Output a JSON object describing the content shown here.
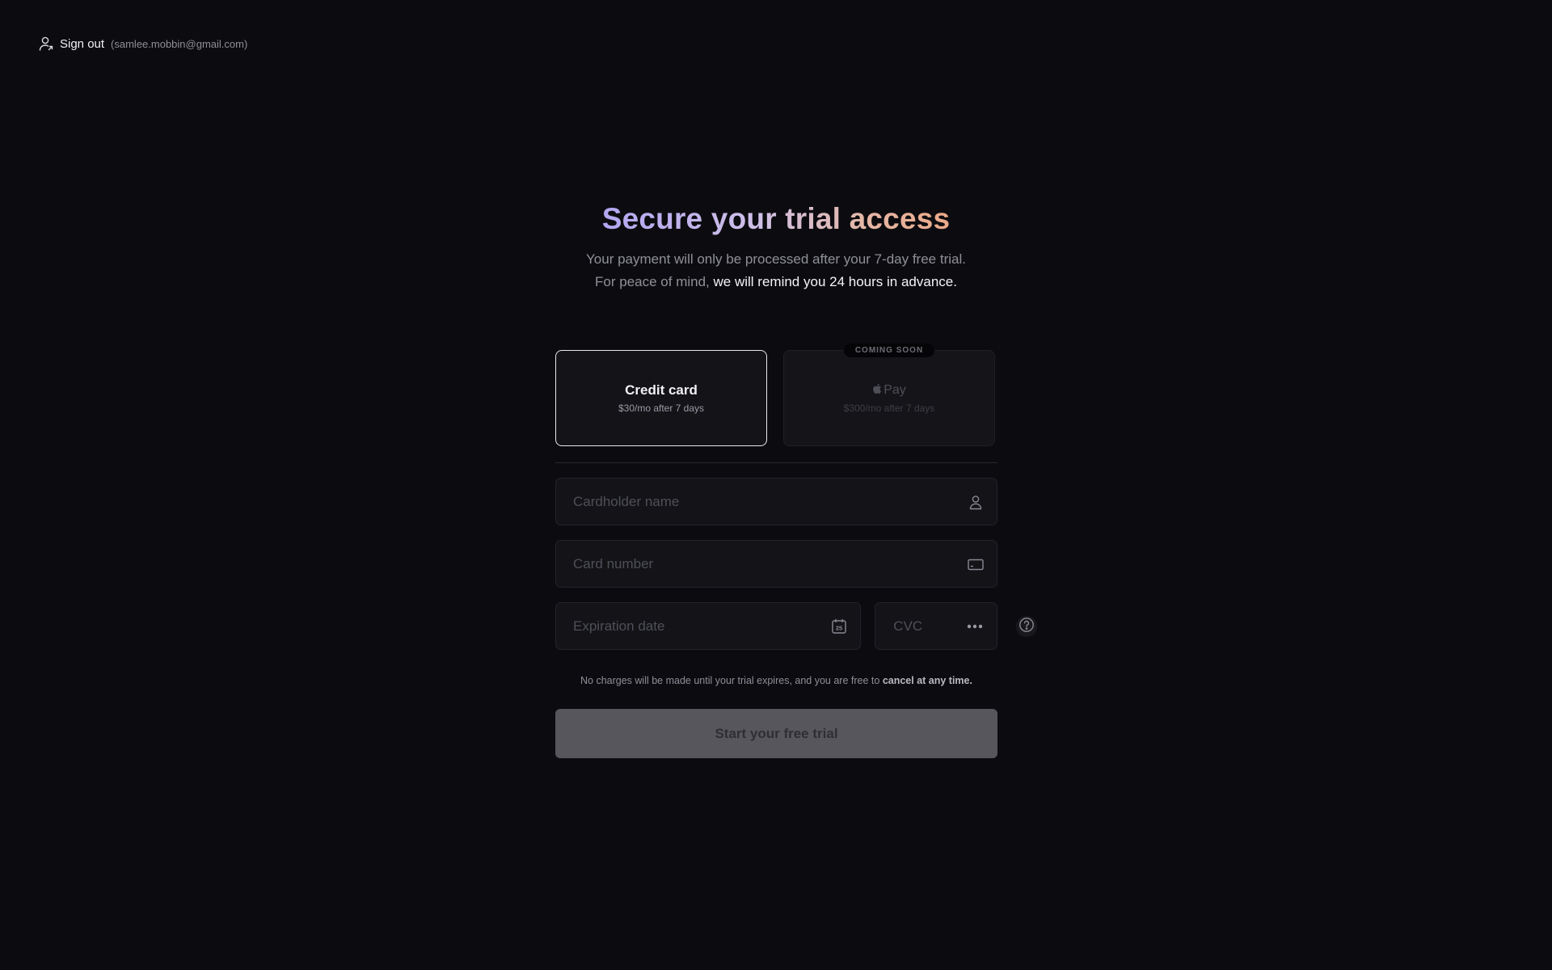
{
  "header": {
    "signout_label": "Sign out",
    "email": "(samlee.mobbin@gmail.com)"
  },
  "hero": {
    "title": "Secure your trial access",
    "line1": "Your payment will only be processed after your 7-day free trial.",
    "line2_prefix": "For peace of mind, ",
    "line2_emphasis": "we will remind you 24 hours in advance."
  },
  "payment_methods": [
    {
      "title": "Credit card",
      "price": "$30/mo after 7 days",
      "selected": true
    },
    {
      "title": "Pay",
      "price": "$300/mo after 7 days",
      "badge": "COMING SOON",
      "disabled": true
    }
  ],
  "fields": {
    "cardholder_placeholder": "Cardholder name",
    "card_number_placeholder": "Card number",
    "expiration_placeholder": "Expiration date",
    "cvc_placeholder": "CVC",
    "calendar_day": "25"
  },
  "notice": {
    "text": "No charges will be made until your trial expires, and you are free to ",
    "emphasis": "cancel at any time."
  },
  "submit_label": "Start your free trial",
  "colors": {
    "background": "#0c0c10",
    "title_gradient_start": "#b3a6f1",
    "title_gradient_end": "#eba98a",
    "submit_bg": "#56565c"
  }
}
